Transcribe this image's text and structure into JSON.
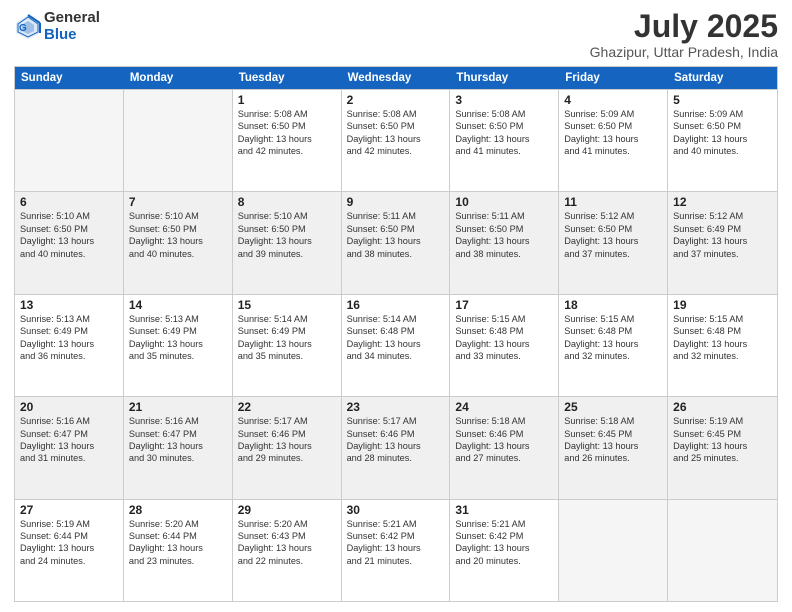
{
  "logo": {
    "line1": "General",
    "line2": "Blue"
  },
  "title": "July 2025",
  "location": "Ghazipur, Uttar Pradesh, India",
  "header_days": [
    "Sunday",
    "Monday",
    "Tuesday",
    "Wednesday",
    "Thursday",
    "Friday",
    "Saturday"
  ],
  "weeks": [
    [
      {
        "day": "",
        "info": "",
        "empty": true
      },
      {
        "day": "",
        "info": "",
        "empty": true
      },
      {
        "day": "1",
        "info": "Sunrise: 5:08 AM\nSunset: 6:50 PM\nDaylight: 13 hours\nand 42 minutes."
      },
      {
        "day": "2",
        "info": "Sunrise: 5:08 AM\nSunset: 6:50 PM\nDaylight: 13 hours\nand 42 minutes."
      },
      {
        "day": "3",
        "info": "Sunrise: 5:08 AM\nSunset: 6:50 PM\nDaylight: 13 hours\nand 41 minutes."
      },
      {
        "day": "4",
        "info": "Sunrise: 5:09 AM\nSunset: 6:50 PM\nDaylight: 13 hours\nand 41 minutes."
      },
      {
        "day": "5",
        "info": "Sunrise: 5:09 AM\nSunset: 6:50 PM\nDaylight: 13 hours\nand 40 minutes."
      }
    ],
    [
      {
        "day": "6",
        "info": "Sunrise: 5:10 AM\nSunset: 6:50 PM\nDaylight: 13 hours\nand 40 minutes.",
        "shaded": true
      },
      {
        "day": "7",
        "info": "Sunrise: 5:10 AM\nSunset: 6:50 PM\nDaylight: 13 hours\nand 40 minutes.",
        "shaded": true
      },
      {
        "day": "8",
        "info": "Sunrise: 5:10 AM\nSunset: 6:50 PM\nDaylight: 13 hours\nand 39 minutes.",
        "shaded": true
      },
      {
        "day": "9",
        "info": "Sunrise: 5:11 AM\nSunset: 6:50 PM\nDaylight: 13 hours\nand 38 minutes.",
        "shaded": true
      },
      {
        "day": "10",
        "info": "Sunrise: 5:11 AM\nSunset: 6:50 PM\nDaylight: 13 hours\nand 38 minutes.",
        "shaded": true
      },
      {
        "day": "11",
        "info": "Sunrise: 5:12 AM\nSunset: 6:50 PM\nDaylight: 13 hours\nand 37 minutes.",
        "shaded": true
      },
      {
        "day": "12",
        "info": "Sunrise: 5:12 AM\nSunset: 6:49 PM\nDaylight: 13 hours\nand 37 minutes.",
        "shaded": true
      }
    ],
    [
      {
        "day": "13",
        "info": "Sunrise: 5:13 AM\nSunset: 6:49 PM\nDaylight: 13 hours\nand 36 minutes."
      },
      {
        "day": "14",
        "info": "Sunrise: 5:13 AM\nSunset: 6:49 PM\nDaylight: 13 hours\nand 35 minutes."
      },
      {
        "day": "15",
        "info": "Sunrise: 5:14 AM\nSunset: 6:49 PM\nDaylight: 13 hours\nand 35 minutes."
      },
      {
        "day": "16",
        "info": "Sunrise: 5:14 AM\nSunset: 6:48 PM\nDaylight: 13 hours\nand 34 minutes."
      },
      {
        "day": "17",
        "info": "Sunrise: 5:15 AM\nSunset: 6:48 PM\nDaylight: 13 hours\nand 33 minutes."
      },
      {
        "day": "18",
        "info": "Sunrise: 5:15 AM\nSunset: 6:48 PM\nDaylight: 13 hours\nand 32 minutes."
      },
      {
        "day": "19",
        "info": "Sunrise: 5:15 AM\nSunset: 6:48 PM\nDaylight: 13 hours\nand 32 minutes."
      }
    ],
    [
      {
        "day": "20",
        "info": "Sunrise: 5:16 AM\nSunset: 6:47 PM\nDaylight: 13 hours\nand 31 minutes.",
        "shaded": true
      },
      {
        "day": "21",
        "info": "Sunrise: 5:16 AM\nSunset: 6:47 PM\nDaylight: 13 hours\nand 30 minutes.",
        "shaded": true
      },
      {
        "day": "22",
        "info": "Sunrise: 5:17 AM\nSunset: 6:46 PM\nDaylight: 13 hours\nand 29 minutes.",
        "shaded": true
      },
      {
        "day": "23",
        "info": "Sunrise: 5:17 AM\nSunset: 6:46 PM\nDaylight: 13 hours\nand 28 minutes.",
        "shaded": true
      },
      {
        "day": "24",
        "info": "Sunrise: 5:18 AM\nSunset: 6:46 PM\nDaylight: 13 hours\nand 27 minutes.",
        "shaded": true
      },
      {
        "day": "25",
        "info": "Sunrise: 5:18 AM\nSunset: 6:45 PM\nDaylight: 13 hours\nand 26 minutes.",
        "shaded": true
      },
      {
        "day": "26",
        "info": "Sunrise: 5:19 AM\nSunset: 6:45 PM\nDaylight: 13 hours\nand 25 minutes.",
        "shaded": true
      }
    ],
    [
      {
        "day": "27",
        "info": "Sunrise: 5:19 AM\nSunset: 6:44 PM\nDaylight: 13 hours\nand 24 minutes."
      },
      {
        "day": "28",
        "info": "Sunrise: 5:20 AM\nSunset: 6:44 PM\nDaylight: 13 hours\nand 23 minutes."
      },
      {
        "day": "29",
        "info": "Sunrise: 5:20 AM\nSunset: 6:43 PM\nDaylight: 13 hours\nand 22 minutes."
      },
      {
        "day": "30",
        "info": "Sunrise: 5:21 AM\nSunset: 6:42 PM\nDaylight: 13 hours\nand 21 minutes."
      },
      {
        "day": "31",
        "info": "Sunrise: 5:21 AM\nSunset: 6:42 PM\nDaylight: 13 hours\nand 20 minutes."
      },
      {
        "day": "",
        "info": "",
        "empty": true
      },
      {
        "day": "",
        "info": "",
        "empty": true
      }
    ]
  ]
}
